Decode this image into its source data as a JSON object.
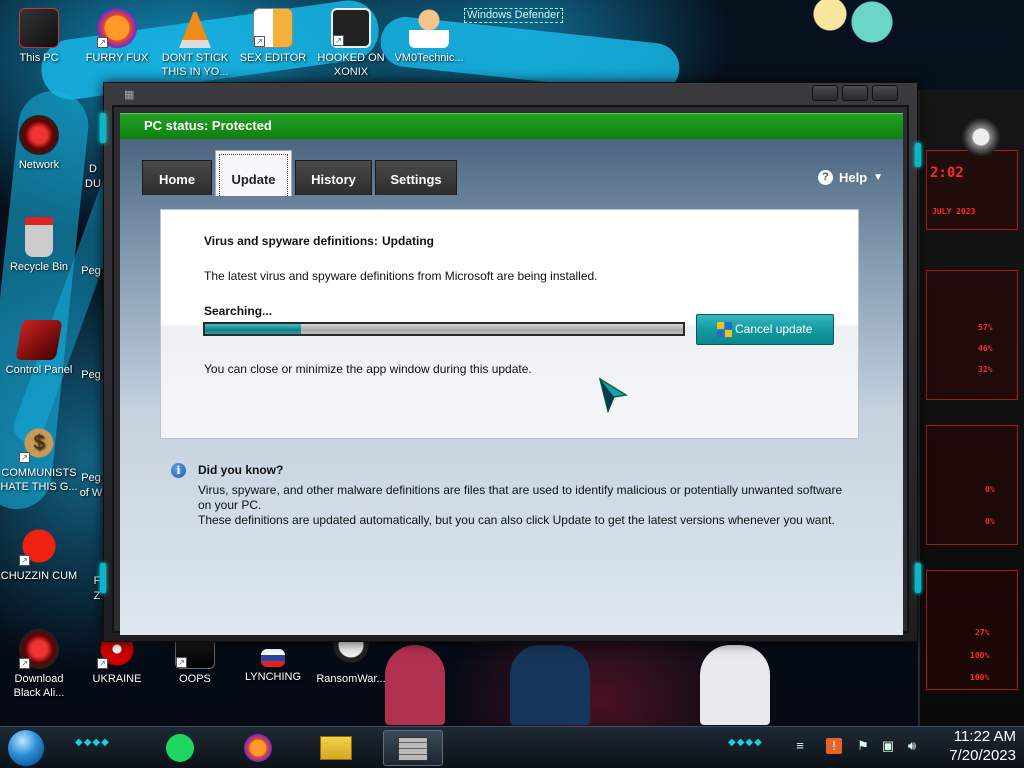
{
  "desktop": {
    "icons": [
      {
        "label": "This PC"
      },
      {
        "label": "FURRY FUX"
      },
      {
        "label": "DONT STICK THIS IN YO..."
      },
      {
        "label": "SEX EDITOR"
      },
      {
        "label": "HOOKED ON XONIX"
      },
      {
        "label": "VM0Technic..."
      },
      {
        "label": "Network"
      },
      {
        "label": "Recycle Bin"
      },
      {
        "label": "Control Panel"
      },
      {
        "label": "COMMUNISTS HATE THIS G..."
      },
      {
        "label": "CHUZZIN CUM"
      },
      {
        "label": "Download Black Ali..."
      },
      {
        "label": "UKRAINE"
      },
      {
        "label": "OOPS"
      },
      {
        "label": "LYNCHING"
      },
      {
        "label": "RansomWar..."
      }
    ],
    "partial_labels": [
      "D",
      "DU",
      "Peg",
      "Peg",
      "Peg",
      "Peg",
      "of W",
      "F",
      "Z"
    ]
  },
  "window": {
    "title": "Windows Defender",
    "status": "PC status: Protected",
    "tabs": [
      {
        "label": "Home",
        "active": false
      },
      {
        "label": "Update",
        "active": true
      },
      {
        "label": "History",
        "active": false
      },
      {
        "label": "Settings",
        "active": false
      }
    ],
    "help_label": "Help",
    "update": {
      "definitions_label": "Virus and spyware definitions:",
      "definitions_status": "Updating",
      "description": "The latest virus and spyware definitions from Microsoft are being installed.",
      "progress_label": "Searching...",
      "progress_fraction": 0.2,
      "cancel_button": "Cancel update",
      "note": "You can close or minimize the app window during this update."
    },
    "did_you_know": {
      "title": "Did you know?",
      "line1": "Virus, spyware, and other malware definitions are files that are used to identify malicious or potentially unwanted software",
      "line2": "on your PC.",
      "line3": "These definitions are updated automatically, but you can also click Update to get the latest versions whenever you want."
    }
  },
  "wallpaper_panel": {
    "readouts": [
      "2:02",
      "JULY 2023",
      "57%",
      "46%",
      "32%",
      "0%",
      "0%",
      "27%",
      "100%",
      "100%"
    ]
  },
  "taskbar": {
    "apps": [
      {
        "icon": "spotify-icon"
      },
      {
        "icon": "firefox-icon"
      },
      {
        "icon": "file-explorer-icon"
      },
      {
        "icon": "windows-defender-icon",
        "active": true
      }
    ],
    "tray": [
      "action-center-icon",
      "notification-icon",
      "flag-icon",
      "network-icon",
      "volume-icon"
    ],
    "clock": {
      "time": "11:22 AM",
      "date": "7/20/2023"
    }
  },
  "colors": {
    "status_green": "#1a9a1a",
    "accent_teal": "#129aa2",
    "panel_red": "#ff2b2b"
  }
}
